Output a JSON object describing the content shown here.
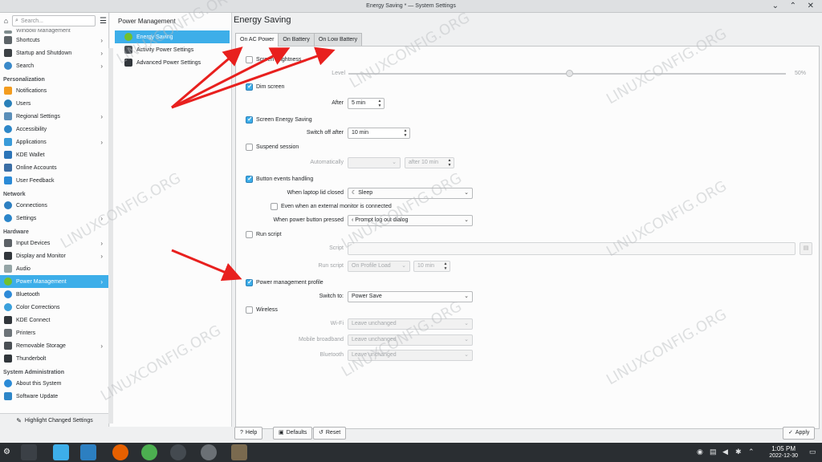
{
  "window": {
    "title": "Energy Saving * — System Settings",
    "min_icon": "minimize-icon",
    "max_icon": "maximize-icon",
    "close_icon": "close-icon"
  },
  "sidebar": {
    "search_placeholder": "Search...",
    "faded_item": "Window Management",
    "groups": [
      {
        "items": [
          "Shortcuts",
          "Startup and Shutdown",
          "Search"
        ]
      },
      {
        "category": "Personalization",
        "items": [
          "Notifications",
          "Users",
          "Regional Settings",
          "Accessibility",
          "Applications",
          "KDE Wallet",
          "Online Accounts",
          "User Feedback"
        ]
      },
      {
        "category": "Network",
        "items": [
          "Connections",
          "Settings"
        ]
      },
      {
        "category": "Hardware",
        "items": [
          "Input Devices",
          "Display and Monitor",
          "Audio",
          "Power Management",
          "Bluetooth",
          "Color Corrections",
          "KDE Connect",
          "Printers",
          "Removable Storage",
          "Thunderbolt"
        ]
      },
      {
        "category": "System Administration",
        "items": [
          "About this System",
          "Software Update"
        ]
      }
    ],
    "shortcuts": "Shortcuts",
    "startup": "Startup and Shutdown",
    "search": "Search",
    "cat_personalization": "Personalization",
    "notifications": "Notifications",
    "users": "Users",
    "regional": "Regional Settings",
    "accessibility": "Accessibility",
    "applications": "Applications",
    "kdewallet": "KDE Wallet",
    "online": "Online Accounts",
    "feedback": "User Feedback",
    "cat_network": "Network",
    "connections": "Connections",
    "settings": "Settings",
    "cat_hardware": "Hardware",
    "input": "Input Devices",
    "display": "Display and Monitor",
    "audio": "Audio",
    "power": "Power Management",
    "bluetooth": "Bluetooth",
    "color": "Color Corrections",
    "kdeconnect": "KDE Connect",
    "printers": "Printers",
    "removable": "Removable Storage",
    "thunderbolt": "Thunderbolt",
    "cat_sysadmin": "System Administration",
    "about": "About this System",
    "update": "Software Update",
    "highlight": "Highlight Changed Settings"
  },
  "pane2": {
    "title": "Power Management",
    "energy": "Energy Saving",
    "activity": "Activity Power Settings",
    "advanced": "Advanced Power Settings"
  },
  "main": {
    "title": "Energy Saving",
    "tabs": [
      "On AC Power",
      "On Battery",
      "On Low Battery"
    ],
    "screen_brightness": "Screen brightness",
    "level": "Level",
    "level_value": "50%",
    "dim_screen": "Dim screen",
    "after": "After",
    "after_value": "5 min",
    "screen_energy": "Screen Energy Saving",
    "switch_off_after": "Switch off after",
    "switch_off_value": "10 min",
    "suspend_session": "Suspend session",
    "automatically": "Automatically",
    "auto_after": "after 10 min",
    "button_events": "Button events handling",
    "lid_closed": "When laptop lid closed",
    "lid_value": "Sleep",
    "external_monitor": "Even when an external monitor is connected",
    "power_button": "When power button pressed",
    "power_button_value": "Prompt log out dialog",
    "run_script": "Run script",
    "script": "Script",
    "run_script_label": "Run script",
    "run_script_when": "On Profile Load",
    "run_script_after": "10 min",
    "pm_profile": "Power management profile",
    "switch_to": "Switch to:",
    "switch_to_value": "Power Save",
    "wireless": "Wireless",
    "wifi": "Wi-Fi",
    "mobile": "Mobile broadband",
    "bluetooth": "Bluetooth",
    "leave": "Leave unchanged",
    "help": "Help",
    "defaults": "Defaults",
    "reset": "Reset",
    "apply": "Apply"
  },
  "taskbar": {
    "time": "1:05 PM",
    "date": "2022-12-30"
  },
  "watermark": "LINUXCONFIG.ORG",
  "colors": {
    "accent": "#3daee9",
    "arrow": "#e8201e",
    "taskbar": "#2a2e32"
  }
}
